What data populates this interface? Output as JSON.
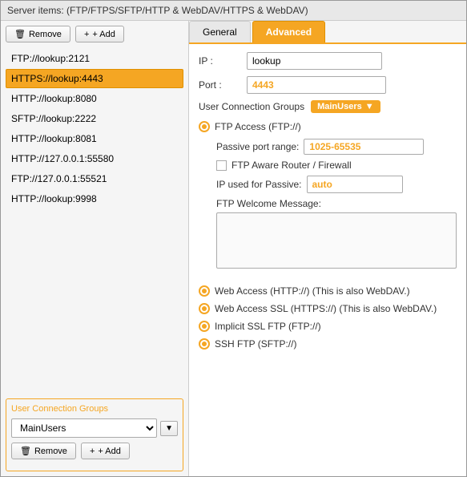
{
  "window": {
    "title": "Server items: (FTP/FTPS/SFTP/HTTP & WebDAV/HTTPS & WebDAV)"
  },
  "left_panel": {
    "remove_button": "Remove",
    "add_button": "+ Add",
    "server_items": [
      {
        "label": "FTP://lookup:2121",
        "selected": false
      },
      {
        "label": "HTTPS://lookup:4443",
        "selected": true
      },
      {
        "label": "HTTP://lookup:8080",
        "selected": false
      },
      {
        "label": "SFTP://lookup:2222",
        "selected": false
      },
      {
        "label": "HTTP://lookup:8081",
        "selected": false
      },
      {
        "label": "HTTP://127.0.0.1:55580",
        "selected": false
      },
      {
        "label": "FTP://127.0.0.1:55521",
        "selected": false
      },
      {
        "label": "HTTP://lookup:9998",
        "selected": false
      }
    ],
    "user_groups_section": {
      "title": "User Connection Groups",
      "selected_group": "MainUsers",
      "remove_button": "Remove",
      "add_button": "+ Add"
    }
  },
  "right_panel": {
    "tabs": [
      {
        "label": "General",
        "active": false
      },
      {
        "label": "Advanced",
        "active": true
      }
    ],
    "general_tab": {
      "ip_label": "IP :",
      "ip_value": "lookup",
      "port_label": "Port :",
      "port_value": "4443",
      "ucg_label": "User Connection Groups",
      "ucg_value": "MainUsers",
      "ftp_access_label": "FTP Access (FTP://)",
      "passive_port_label": "Passive port range:",
      "passive_port_value": "1025-65535",
      "ftp_aware_label": "FTP Aware Router / Firewall",
      "ip_passive_label": "IP used for Passive:",
      "ip_passive_value": "auto",
      "welcome_label": "FTP Welcome Message:",
      "welcome_value": "",
      "web_access_label": "Web Access (HTTP://) (This is also WebDAV.)",
      "web_access_ssl_label": "Web Access SSL (HTTPS://) (This is also WebDAV.)",
      "implicit_ssl_label": "Implicit SSL FTP (FTP://)",
      "ssh_ftp_label": "SSH FTP (SFTP://)"
    }
  },
  "icons": {
    "remove_icon": "🗑",
    "add_icon": "+",
    "arrow_down": "▼"
  }
}
